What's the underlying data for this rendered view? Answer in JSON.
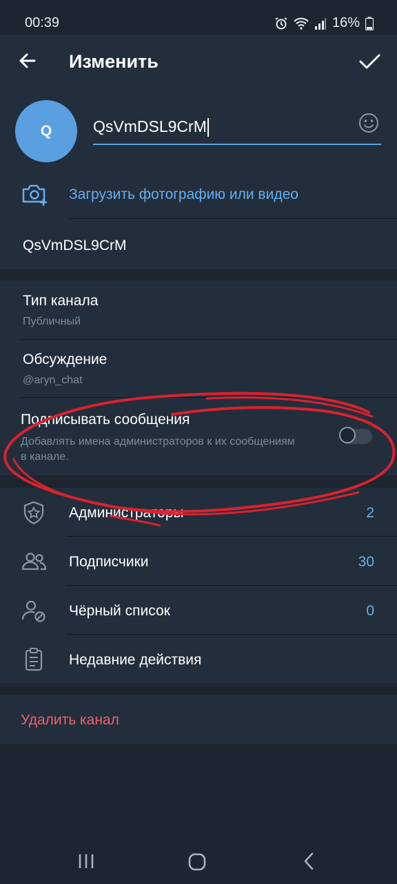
{
  "status_bar": {
    "time": "00:39",
    "battery": "16%"
  },
  "app_bar": {
    "title": "Изменить"
  },
  "profile": {
    "avatar_letter": "Q",
    "name_value": "QsVmDSL9CrM",
    "upload_label": "Загрузить фотографию или видео",
    "description_value": "QsVmDSL9CrM"
  },
  "settings": {
    "channel_type": {
      "title": "Тип канала",
      "value": "Публичный"
    },
    "discussion": {
      "title": "Обсуждение",
      "value": "@aryn_chat"
    },
    "sign_messages": {
      "title": "Подписывать сообщения",
      "description": "Добавлять имена администраторов к их сообщениям в канале.",
      "enabled": false
    }
  },
  "management": [
    {
      "label": "Администраторы",
      "count": "2",
      "icon": "admin-shield-icon"
    },
    {
      "label": "Подписчики",
      "count": "30",
      "icon": "subscribers-icon"
    },
    {
      "label": "Чёрный список",
      "count": "0",
      "icon": "blocked-user-icon"
    },
    {
      "label": "Недавние действия",
      "count": "",
      "icon": "recent-actions-icon"
    }
  ],
  "delete": {
    "label": "Удалить канал"
  },
  "colors": {
    "background": "#1c2530",
    "surface": "#232e3c",
    "accent": "#66aef0",
    "danger": "#e8636a",
    "annotation": "#d9222f"
  }
}
